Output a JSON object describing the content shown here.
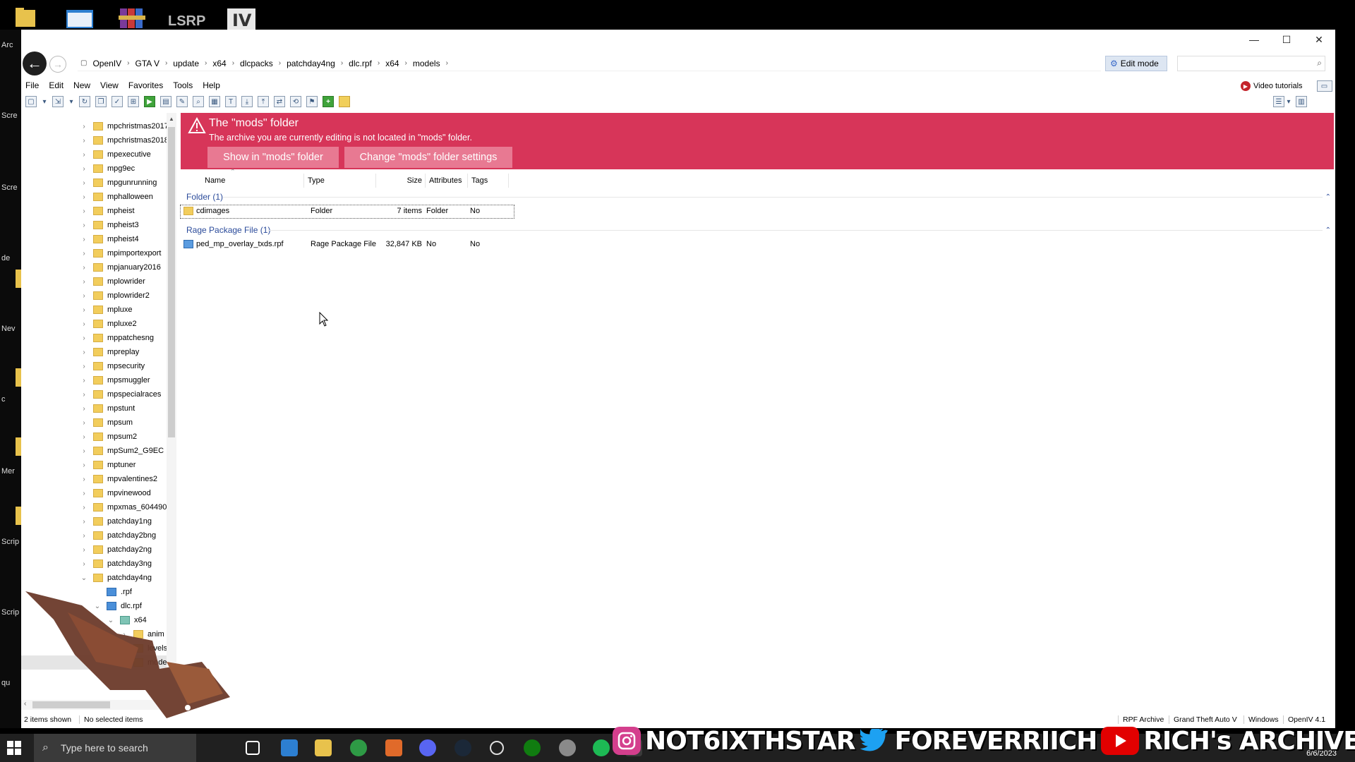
{
  "desktop": {
    "top_icon_label": "LSRP",
    "left_labels": [
      "Arc",
      "Scre",
      "Scre",
      "de",
      "Nev",
      "c",
      "Mer",
      "Scrip",
      "Scrip",
      "qu"
    ]
  },
  "window": {
    "controls": {
      "minimize": "—",
      "maximize": "☐",
      "close": "✕"
    },
    "breadcrumb": [
      "OpenIV",
      "GTA V",
      "update",
      "x64",
      "dlcpacks",
      "patchday4ng",
      "dlc.rpf",
      "x64",
      "models"
    ],
    "edit_mode_label": "Edit mode",
    "search_placeholder": "",
    "menu": [
      "File",
      "Edit",
      "New",
      "View",
      "Favorites",
      "Tools",
      "Help"
    ],
    "video_tutorials": "Video tutorials"
  },
  "tree": {
    "items": [
      "mpchristmas2017",
      "mpchristmas2018",
      "mpexecutive",
      "mpg9ec",
      "mpgunrunning",
      "mphalloween",
      "mpheist",
      "mpheist3",
      "mpheist4",
      "mpimportexport",
      "mpjanuary2016",
      "mplowrider",
      "mplowrider2",
      "mpluxe",
      "mpluxe2",
      "mppatchesng",
      "mpreplay",
      "mpsecurity",
      "mpsmuggler",
      "mpspecialraces",
      "mpstunt",
      "mpsum",
      "mpsum2",
      "mpSum2_G9EC",
      "mptuner",
      "mpvalentines2",
      "mpvinewood",
      "mpxmas_604490",
      "patchday1ng",
      "patchday2bng",
      "patchday2ng",
      "patchday3ng"
    ],
    "expanded": [
      {
        "label": "patchday4ng",
        "indent": 0,
        "icon": "folder",
        "chev": "⌄"
      },
      {
        "label": ".rpf",
        "indent": 1,
        "icon": "rpf",
        "chev": ""
      },
      {
        "label": "dlc.rpf",
        "indent": 1,
        "icon": "rpf",
        "chev": "⌄"
      },
      {
        "label": "x64",
        "indent": 2,
        "icon": "x64",
        "chev": "⌄"
      },
      {
        "label": "anim",
        "indent": 3,
        "icon": "folder",
        "chev": "›"
      },
      {
        "label": "levels",
        "indent": 3,
        "icon": "folder",
        "chev": ""
      },
      {
        "label": "model",
        "indent": 3,
        "icon": "folder",
        "chev": ""
      },
      {
        "label": "",
        "indent": 0,
        "icon": "",
        "chev": ""
      },
      {
        "label": "",
        "indent": 0,
        "icon": "",
        "chev": ""
      },
      {
        "label": "patc",
        "indent": 0,
        "icon": "folder",
        "chev": "›"
      }
    ]
  },
  "banner": {
    "title": "The \"mods\" folder",
    "text": "The archive you are currently editing is not located in \"mods\" folder.",
    "button_show": "Show in \"mods\" folder",
    "button_change": "Change \"mods\" folder settings",
    "color": "#d73559"
  },
  "list": {
    "columns": [
      "Name",
      "Type",
      "Size",
      "Attributes",
      "Tags"
    ],
    "groups": [
      {
        "label": "Folder (1)",
        "rows": [
          {
            "name": "cdimages",
            "type": "Folder",
            "size": "7 items",
            "attributes": "Folder",
            "tags": "No",
            "icon": "folder"
          }
        ]
      },
      {
        "label": "Rage Package File (1)",
        "rows": [
          {
            "name": "ped_mp_overlay_txds.rpf",
            "type": "Rage Package File",
            "size": "32,847 KB",
            "attributes": "No",
            "tags": "No",
            "icon": "rpf"
          }
        ]
      }
    ]
  },
  "status": {
    "items_shown": "2 items shown",
    "selected": "No selected items",
    "right": [
      "RPF Archive",
      "Grand Theft Auto V",
      "Windows",
      "OpenIV 4.1"
    ]
  },
  "taskbar": {
    "search_placeholder": "Type here to search",
    "date": "6/6/2023"
  },
  "overlay": {
    "instagram": "NOT6IXTHSTAR",
    "twitter": "FOREVERRIICH",
    "youtube": "RICH's ARCHIVE"
  }
}
